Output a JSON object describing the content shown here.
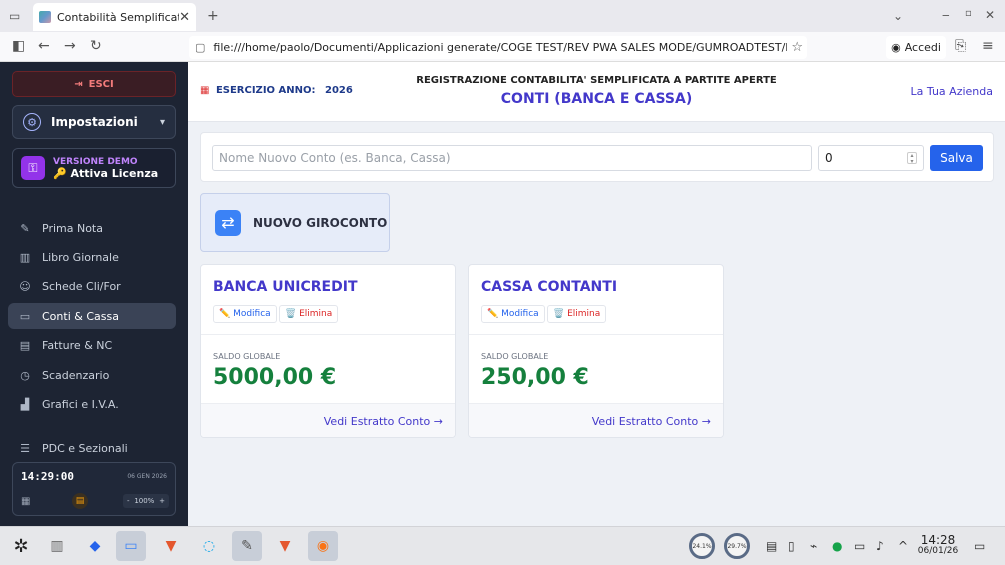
{
  "browser": {
    "tab_title": "Contabilità Semplificata",
    "url": "file:///home/paolo/Documenti/Applicazioni generate/COGE TEST/REV PWA SALES MODE/GUMROADTEST/DIST_NETLIFY",
    "accedi_label": "Accedi"
  },
  "sidebar": {
    "esci_label": "ESCI",
    "impostazioni_label": "Impostazioni",
    "demo_line1": "VERSIONE DEMO",
    "demo_line2": "🔑 Attiva Licenza",
    "items": [
      {
        "label": "Prima Nota",
        "icon": "edit-icon"
      },
      {
        "label": "Libro Giornale",
        "icon": "book-icon"
      },
      {
        "label": "Schede Cli/For",
        "icon": "users-icon"
      },
      {
        "label": "Conti & Cassa",
        "icon": "wallet-icon",
        "active": true
      },
      {
        "label": "Fatture & NC",
        "icon": "invoice-icon"
      },
      {
        "label": "Scadenzario",
        "icon": "clock-icon"
      },
      {
        "label": "Grafici e I.V.A.",
        "icon": "chart-icon"
      },
      {
        "label": "PDC e Sezionali",
        "icon": "list-icon"
      }
    ],
    "clock_time": "14:29:00",
    "clock_date": "06 GEN 2026",
    "zoom_minus": "-",
    "zoom_value": "100%",
    "zoom_plus": "+"
  },
  "header": {
    "esercizio_label": "ESERCIZIO ANNO:",
    "esercizio_year": "2026",
    "title": "REGISTRAZIONE CONTABILITA' SEMPLIFICATA A PARTITE APERTE",
    "subtitle": "CONTI (BANCA E CASSA)",
    "azienda": "La Tua Azienda"
  },
  "form": {
    "name_placeholder": "Nome Nuovo Conto (es. Banca, Cassa)",
    "initial_value": "0",
    "save_label": "Salva"
  },
  "giroconto_label": "NUOVO GIROCONTO",
  "accounts": [
    {
      "name": "BANCA UNICREDIT",
      "modifica": "✏️ Modifica",
      "elimina": "🗑️ Elimina",
      "saldo_label": "SALDO GLOBALE",
      "saldo": "5000,00 €",
      "link": "Vedi Estratto Conto →"
    },
    {
      "name": "CASSA CONTANTI",
      "modifica": "✏️ Modifica",
      "elimina": "🗑️ Elimina",
      "saldo_label": "SALDO GLOBALE",
      "saldo": "250,00 €",
      "link": "Vedi Estratto Conto →"
    }
  ],
  "taskbar": {
    "cpu1": "24.1%",
    "cpu2": "29.7%",
    "time": "14:28",
    "date": "06/01/26"
  }
}
